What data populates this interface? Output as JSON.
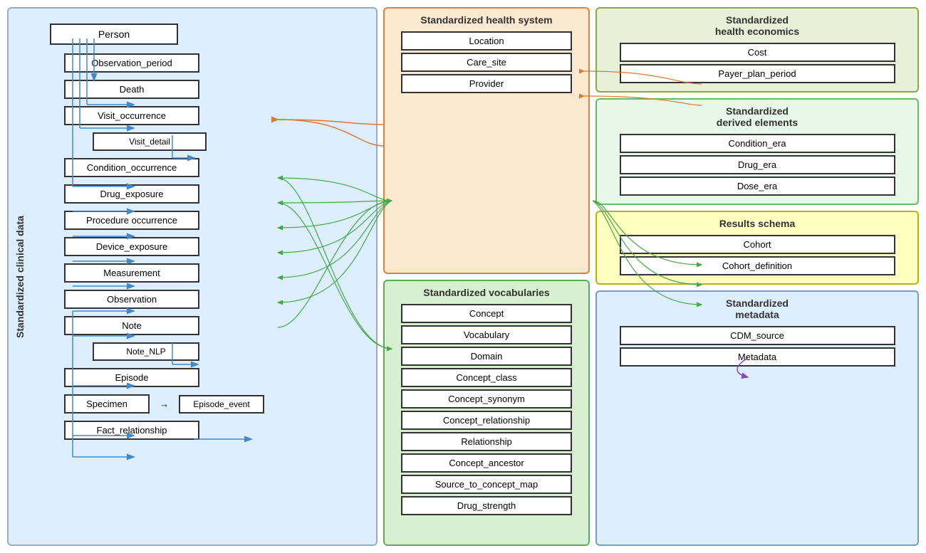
{
  "clinical": {
    "panel_label": "Standardized clinical data",
    "entities": [
      {
        "id": "person",
        "label": "Person",
        "indent": 0
      },
      {
        "id": "obs_period",
        "label": "Observation_period",
        "indent": 1
      },
      {
        "id": "death",
        "label": "Death",
        "indent": 1
      },
      {
        "id": "visit_occ",
        "label": "Visit_occurrence",
        "indent": 1
      },
      {
        "id": "visit_detail",
        "label": "Visit_detail",
        "indent": 2
      },
      {
        "id": "cond_occ",
        "label": "Condition_occurrence",
        "indent": 1
      },
      {
        "id": "drug_exp",
        "label": "Drug_exposure",
        "indent": 1
      },
      {
        "id": "proc_occ",
        "label": "Procedure occurrence",
        "indent": 1
      },
      {
        "id": "device_exp",
        "label": "Device_exposure",
        "indent": 1
      },
      {
        "id": "measurement",
        "label": "Measurement",
        "indent": 1
      },
      {
        "id": "observation",
        "label": "Observation",
        "indent": 1
      },
      {
        "id": "note",
        "label": "Note",
        "indent": 1
      },
      {
        "id": "note_nlp",
        "label": "Note_NLP",
        "indent": 2
      },
      {
        "id": "episode",
        "label": "Episode",
        "indent": 1
      },
      {
        "id": "specimen",
        "label": "Specimen",
        "indent": 1
      },
      {
        "id": "episode_event",
        "label": "Episode_event",
        "indent": 2
      },
      {
        "id": "fact_rel",
        "label": "Fact_relationship",
        "indent": 1
      }
    ]
  },
  "health_system": {
    "title": "Standardized health system",
    "entities": [
      "Location",
      "Care_site",
      "Provider"
    ]
  },
  "vocabularies": {
    "title": "Standardized vocabularies",
    "entities": [
      "Concept",
      "Vocabulary",
      "Domain",
      "Concept_class",
      "Concept_synonym",
      "Concept_relationship",
      "Relationship",
      "Concept_ancestor",
      "Source_to_concept_map",
      "Drug_strength"
    ]
  },
  "health_econ": {
    "title": "Standardized health economics",
    "entities": [
      "Cost",
      "Payer_plan_period"
    ]
  },
  "derived": {
    "title": "Standardized derived elements",
    "entities": [
      "Condition_era",
      "Drug_era",
      "Dose_era"
    ]
  },
  "results": {
    "title": "Results schema",
    "entities": [
      "Cohort",
      "Cohort_definition"
    ]
  },
  "metadata": {
    "title": "Standardized metadata",
    "entities": [
      "CDM_source",
      "Metadata"
    ]
  }
}
